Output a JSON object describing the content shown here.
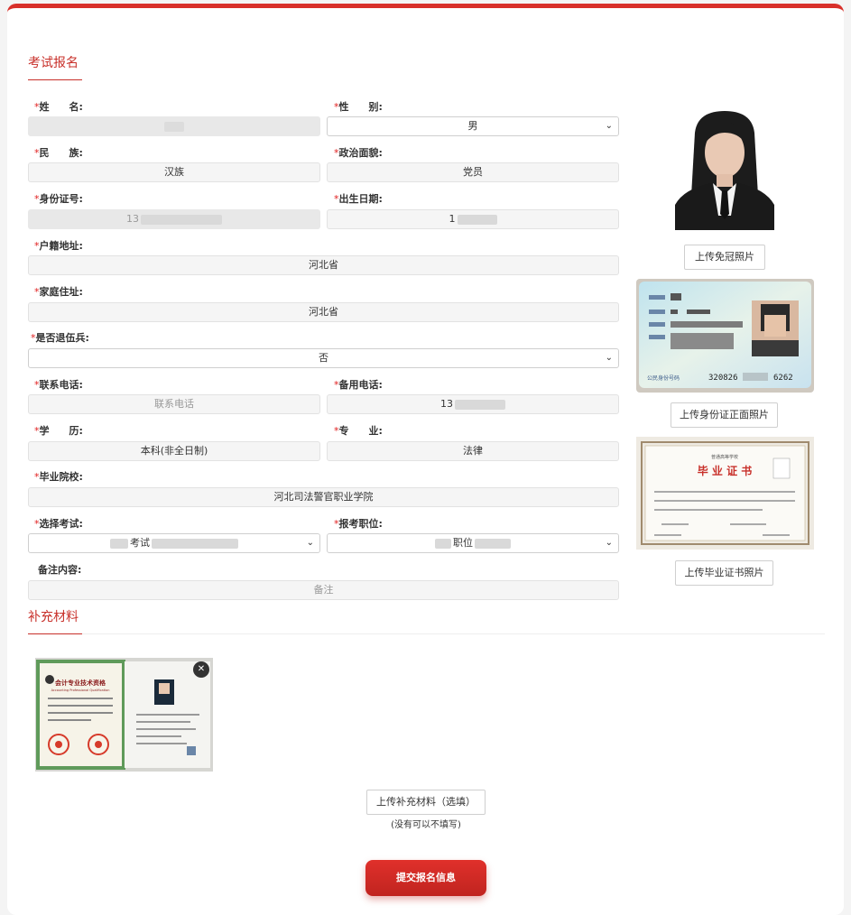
{
  "section_main": "考试报名",
  "section_extra": "补充材料",
  "fields": {
    "name": {
      "label": "姓　　名:",
      "value": ""
    },
    "gender": {
      "label": "性　　别:",
      "value": "男"
    },
    "ethnicity": {
      "label": "民　　族:",
      "value": "汉族"
    },
    "political": {
      "label": "政治面貌:",
      "value": "党员"
    },
    "id_number": {
      "label": "身份证号:",
      "value": "13"
    },
    "birthdate": {
      "label": "出生日期:",
      "value": "1"
    },
    "hukou": {
      "label": "户籍地址:",
      "value": "河北省"
    },
    "home": {
      "label": "家庭住址:",
      "value": "河北省"
    },
    "veteran": {
      "label": "是否退伍兵:",
      "value": "否"
    },
    "phone": {
      "label": "联系电话:",
      "placeholder": "联系电话"
    },
    "backup_phone": {
      "label": "备用电话:",
      "value": "13"
    },
    "education": {
      "label": "学　　历:",
      "value": "本科(非全日制)"
    },
    "major": {
      "label": "专　　业:",
      "value": "法律"
    },
    "school": {
      "label": "毕业院校:",
      "value": "河北司法警官职业学院"
    },
    "exam": {
      "label": "选择考试:",
      "value": "考试"
    },
    "position": {
      "label": "报考职位:",
      "value": "职位"
    },
    "remark": {
      "label": "备注内容:",
      "placeholder": "备注"
    }
  },
  "right_panel": {
    "upload_photo": "上传免冠照片",
    "upload_id": "上传身份证正面照片",
    "upload_diploma": "上传毕业证书照片",
    "id_card_number_label": "公民身份号码",
    "id_card_number": "320826",
    "id_card_number_tail": "6262",
    "diploma_school": "普通高等学校",
    "diploma_title": "毕 业 证 书"
  },
  "extra": {
    "cert_title": "会计专业技术资格",
    "cert_subtitle": "Accounting Professional Qualification",
    "upload_btn": "上传补充材料（选填）",
    "note": "(没有可以不填写)"
  },
  "submit": "提交报名信息",
  "colors": {
    "brand": "#d8302a",
    "required_star": "#e02020"
  }
}
